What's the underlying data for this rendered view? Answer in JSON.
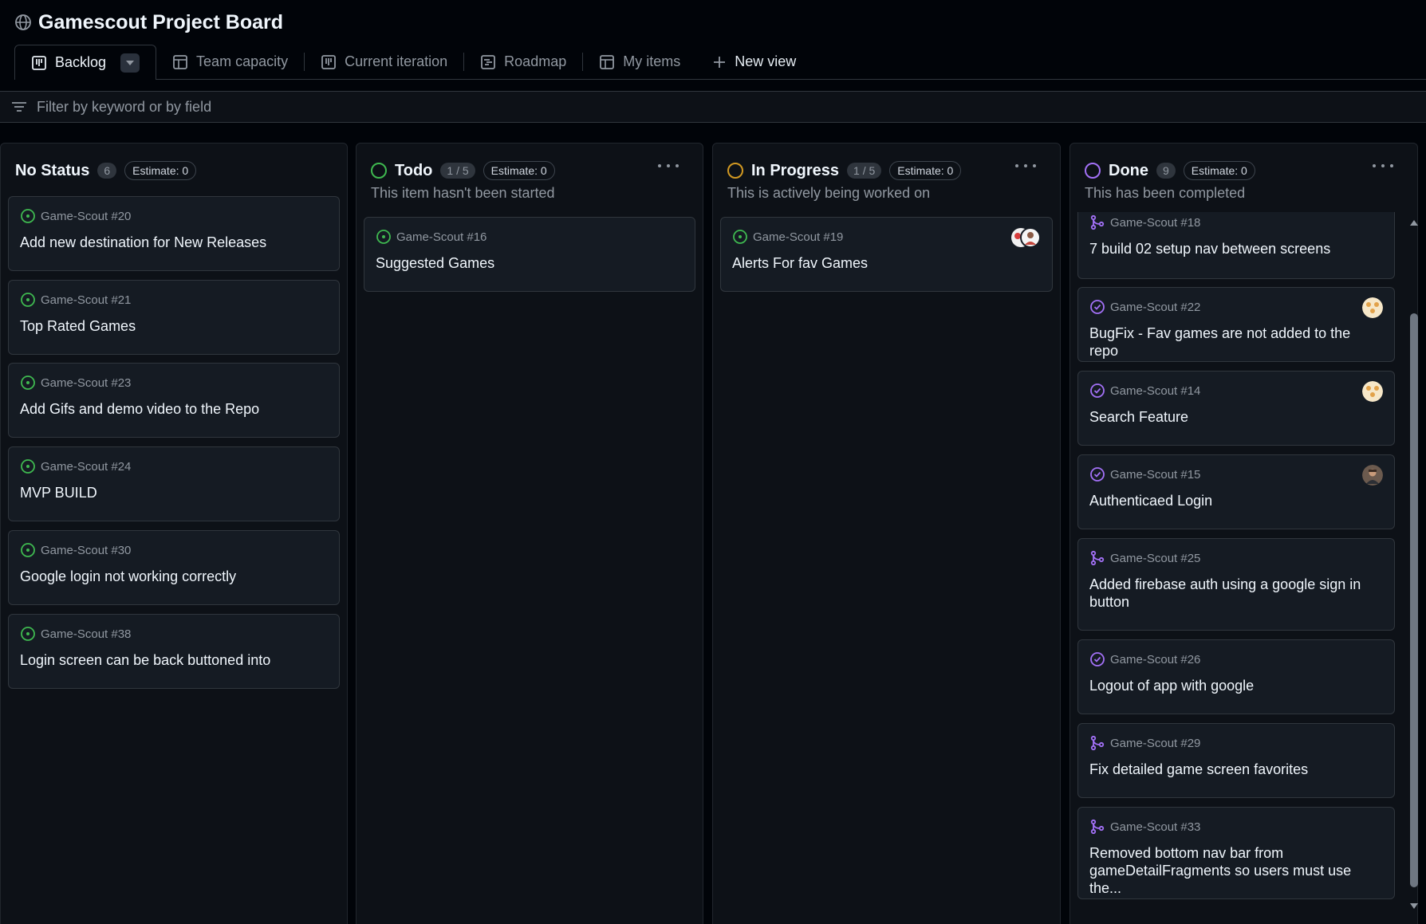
{
  "app": {
    "title": "Gamescout Project Board"
  },
  "tabs": [
    {
      "label": "Backlog",
      "icon": "board-icon",
      "active": true
    },
    {
      "label": "Team capacity",
      "icon": "table-icon"
    },
    {
      "label": "Current iteration",
      "icon": "board-icon"
    },
    {
      "label": "Roadmap",
      "icon": "roadmap-icon"
    },
    {
      "label": "My items",
      "icon": "table-icon"
    }
  ],
  "new_view": {
    "label": "New view"
  },
  "filter": {
    "placeholder": "Filter by keyword or by field"
  },
  "colors": {
    "green": "#3fb950",
    "yellow": "#d29922",
    "purple": "#a371f7"
  },
  "columns": [
    {
      "title": "No Status",
      "count": "6",
      "estimate": "Estimate: 0",
      "description": "",
      "cards": [
        {
          "ref": "Game-Scout #20",
          "title": "Add new destination for New Releases",
          "icon": "issue-open-icon"
        },
        {
          "ref": "Game-Scout #21",
          "title": "Top Rated Games",
          "icon": "issue-open-icon"
        },
        {
          "ref": "Game-Scout #23",
          "title": "Add Gifs and demo video to the Repo",
          "icon": "issue-open-icon"
        },
        {
          "ref": "Game-Scout #24",
          "title": "MVP BUILD",
          "icon": "issue-open-icon"
        },
        {
          "ref": "Game-Scout #30",
          "title": "Google login not working correctly",
          "icon": "issue-open-icon"
        },
        {
          "ref": "Game-Scout #38",
          "title": "Login screen can be back buttoned into",
          "icon": "issue-open-icon"
        }
      ]
    },
    {
      "title": "Todo",
      "count": "1 / 5",
      "estimate": "Estimate: 0",
      "description": "This item hasn't been started",
      "cards": [
        {
          "ref": "Game-Scout #16",
          "title": "Suggested Games",
          "icon": "issue-open-icon"
        }
      ]
    },
    {
      "title": "In Progress",
      "count": "1 / 5",
      "estimate": "Estimate: 0",
      "description": "This is actively being worked on",
      "cards": [
        {
          "ref": "Game-Scout #19",
          "title": "Alerts For fav Games",
          "icon": "issue-open-icon",
          "avatar": "avatars-icon"
        }
      ]
    },
    {
      "title": "Done",
      "count": "9",
      "estimate": "Estimate: 0",
      "description": "This has been completed",
      "cards": [
        {
          "ref": "Game-Scout #18",
          "title": "7 build 02 setup nav between screens",
          "icon": "pr-merged-icon"
        },
        {
          "ref": "Game-Scout #22",
          "title": "BugFix - Fav games are not added to the repo",
          "icon": "issue-closed-icon",
          "avatar": "avatar-icon"
        },
        {
          "ref": "Game-Scout #14",
          "title": "Search Feature",
          "icon": "issue-closed-icon",
          "avatar": "avatar-icon"
        },
        {
          "ref": "Game-Scout #15",
          "title": "Authenticaed Login",
          "icon": "issue-closed-icon",
          "avatar": "avatar-icon"
        },
        {
          "ref": "Game-Scout #25",
          "title": "Added firebase auth using a google sign in button",
          "icon": "pr-merged-icon"
        },
        {
          "ref": "Game-Scout #26",
          "title": "Logout of app with google",
          "icon": "issue-closed-icon"
        },
        {
          "ref": "Game-Scout #29",
          "title": "Fix detailed game screen favorites",
          "icon": "pr-merged-icon"
        },
        {
          "ref": "Game-Scout #33",
          "title": "Removed bottom nav bar from gameDetailFragments so users must use the...",
          "icon": "pr-merged-icon"
        }
      ]
    }
  ]
}
